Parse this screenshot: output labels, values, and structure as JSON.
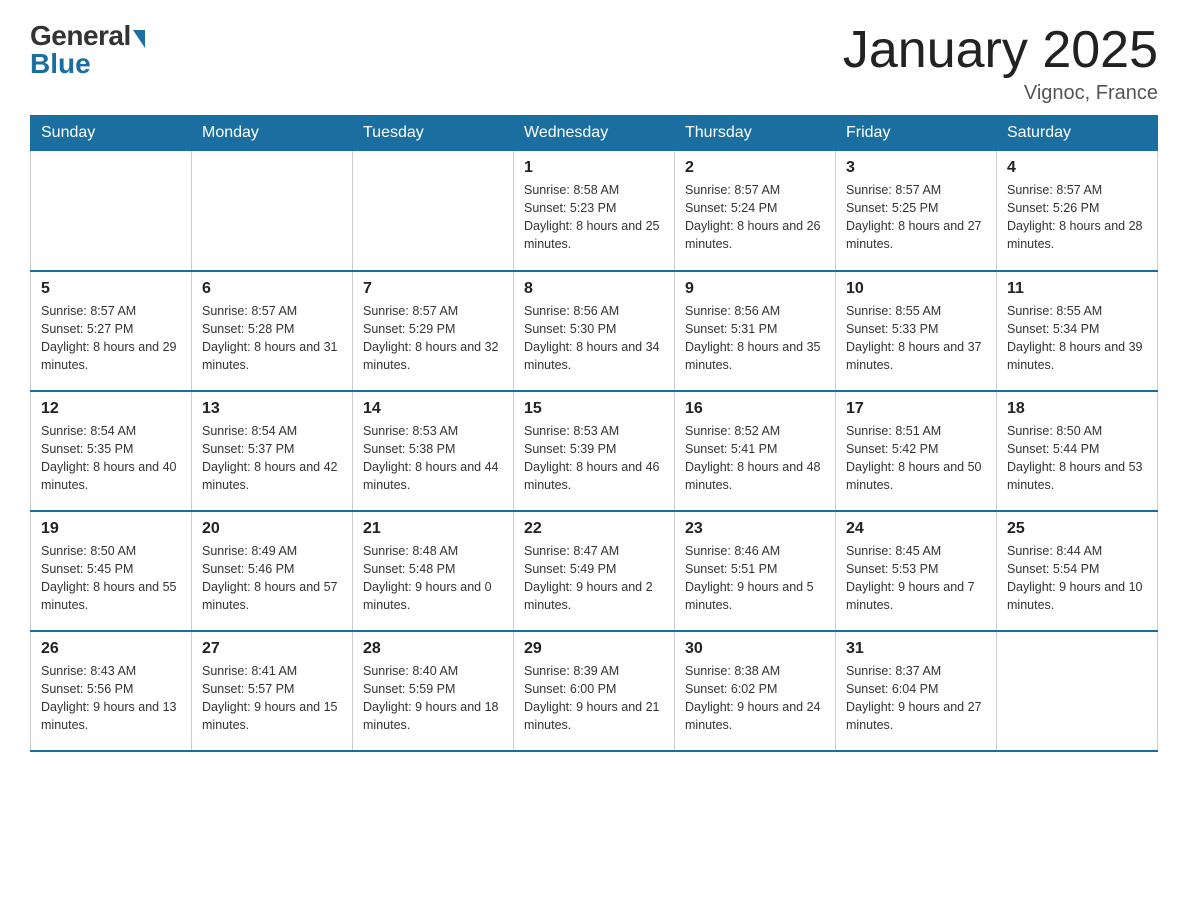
{
  "header": {
    "logo_general": "General",
    "logo_blue": "Blue",
    "title": "January 2025",
    "subtitle": "Vignoc, France"
  },
  "weekdays": [
    "Sunday",
    "Monday",
    "Tuesday",
    "Wednesday",
    "Thursday",
    "Friday",
    "Saturday"
  ],
  "weeks": [
    [
      {
        "day": "",
        "info": ""
      },
      {
        "day": "",
        "info": ""
      },
      {
        "day": "",
        "info": ""
      },
      {
        "day": "1",
        "info": "Sunrise: 8:58 AM\nSunset: 5:23 PM\nDaylight: 8 hours\nand 25 minutes."
      },
      {
        "day": "2",
        "info": "Sunrise: 8:57 AM\nSunset: 5:24 PM\nDaylight: 8 hours\nand 26 minutes."
      },
      {
        "day": "3",
        "info": "Sunrise: 8:57 AM\nSunset: 5:25 PM\nDaylight: 8 hours\nand 27 minutes."
      },
      {
        "day": "4",
        "info": "Sunrise: 8:57 AM\nSunset: 5:26 PM\nDaylight: 8 hours\nand 28 minutes."
      }
    ],
    [
      {
        "day": "5",
        "info": "Sunrise: 8:57 AM\nSunset: 5:27 PM\nDaylight: 8 hours\nand 29 minutes."
      },
      {
        "day": "6",
        "info": "Sunrise: 8:57 AM\nSunset: 5:28 PM\nDaylight: 8 hours\nand 31 minutes."
      },
      {
        "day": "7",
        "info": "Sunrise: 8:57 AM\nSunset: 5:29 PM\nDaylight: 8 hours\nand 32 minutes."
      },
      {
        "day": "8",
        "info": "Sunrise: 8:56 AM\nSunset: 5:30 PM\nDaylight: 8 hours\nand 34 minutes."
      },
      {
        "day": "9",
        "info": "Sunrise: 8:56 AM\nSunset: 5:31 PM\nDaylight: 8 hours\nand 35 minutes."
      },
      {
        "day": "10",
        "info": "Sunrise: 8:55 AM\nSunset: 5:33 PM\nDaylight: 8 hours\nand 37 minutes."
      },
      {
        "day": "11",
        "info": "Sunrise: 8:55 AM\nSunset: 5:34 PM\nDaylight: 8 hours\nand 39 minutes."
      }
    ],
    [
      {
        "day": "12",
        "info": "Sunrise: 8:54 AM\nSunset: 5:35 PM\nDaylight: 8 hours\nand 40 minutes."
      },
      {
        "day": "13",
        "info": "Sunrise: 8:54 AM\nSunset: 5:37 PM\nDaylight: 8 hours\nand 42 minutes."
      },
      {
        "day": "14",
        "info": "Sunrise: 8:53 AM\nSunset: 5:38 PM\nDaylight: 8 hours\nand 44 minutes."
      },
      {
        "day": "15",
        "info": "Sunrise: 8:53 AM\nSunset: 5:39 PM\nDaylight: 8 hours\nand 46 minutes."
      },
      {
        "day": "16",
        "info": "Sunrise: 8:52 AM\nSunset: 5:41 PM\nDaylight: 8 hours\nand 48 minutes."
      },
      {
        "day": "17",
        "info": "Sunrise: 8:51 AM\nSunset: 5:42 PM\nDaylight: 8 hours\nand 50 minutes."
      },
      {
        "day": "18",
        "info": "Sunrise: 8:50 AM\nSunset: 5:44 PM\nDaylight: 8 hours\nand 53 minutes."
      }
    ],
    [
      {
        "day": "19",
        "info": "Sunrise: 8:50 AM\nSunset: 5:45 PM\nDaylight: 8 hours\nand 55 minutes."
      },
      {
        "day": "20",
        "info": "Sunrise: 8:49 AM\nSunset: 5:46 PM\nDaylight: 8 hours\nand 57 minutes."
      },
      {
        "day": "21",
        "info": "Sunrise: 8:48 AM\nSunset: 5:48 PM\nDaylight: 9 hours\nand 0 minutes."
      },
      {
        "day": "22",
        "info": "Sunrise: 8:47 AM\nSunset: 5:49 PM\nDaylight: 9 hours\nand 2 minutes."
      },
      {
        "day": "23",
        "info": "Sunrise: 8:46 AM\nSunset: 5:51 PM\nDaylight: 9 hours\nand 5 minutes."
      },
      {
        "day": "24",
        "info": "Sunrise: 8:45 AM\nSunset: 5:53 PM\nDaylight: 9 hours\nand 7 minutes."
      },
      {
        "day": "25",
        "info": "Sunrise: 8:44 AM\nSunset: 5:54 PM\nDaylight: 9 hours\nand 10 minutes."
      }
    ],
    [
      {
        "day": "26",
        "info": "Sunrise: 8:43 AM\nSunset: 5:56 PM\nDaylight: 9 hours\nand 13 minutes."
      },
      {
        "day": "27",
        "info": "Sunrise: 8:41 AM\nSunset: 5:57 PM\nDaylight: 9 hours\nand 15 minutes."
      },
      {
        "day": "28",
        "info": "Sunrise: 8:40 AM\nSunset: 5:59 PM\nDaylight: 9 hours\nand 18 minutes."
      },
      {
        "day": "29",
        "info": "Sunrise: 8:39 AM\nSunset: 6:00 PM\nDaylight: 9 hours\nand 21 minutes."
      },
      {
        "day": "30",
        "info": "Sunrise: 8:38 AM\nSunset: 6:02 PM\nDaylight: 9 hours\nand 24 minutes."
      },
      {
        "day": "31",
        "info": "Sunrise: 8:37 AM\nSunset: 6:04 PM\nDaylight: 9 hours\nand 27 minutes."
      },
      {
        "day": "",
        "info": ""
      }
    ]
  ]
}
